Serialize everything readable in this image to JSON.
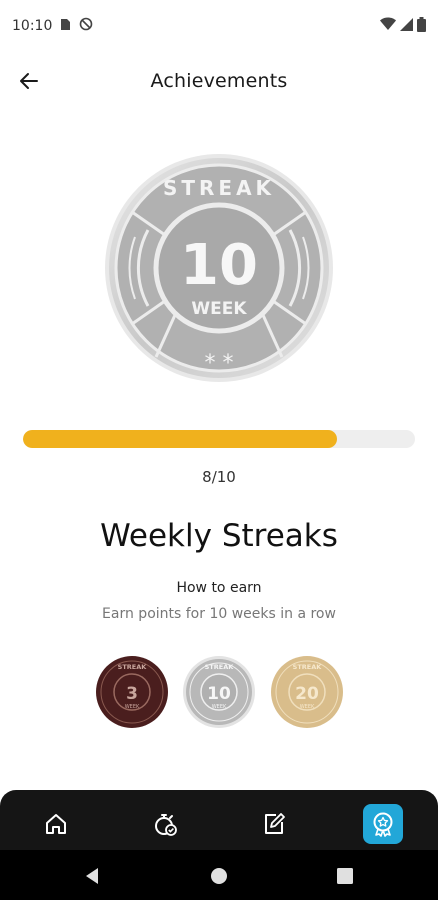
{
  "status_bar": {
    "time": "10:10"
  },
  "app_bar": {
    "title": "Achievements"
  },
  "hero_badge": {
    "banner": "STREAK",
    "number": "10",
    "unit": "WEEK",
    "stars": "* *"
  },
  "progress": {
    "current": 8,
    "total": 10,
    "fraction": 0.8,
    "label": "8/10"
  },
  "achievement": {
    "title": "Weekly Streaks",
    "how_to_earn": "How to earn",
    "description": "Earn points for 10 weeks in a row"
  },
  "levels": [
    {
      "banner": "STREAK",
      "number": "3",
      "unit": "WEEK",
      "color": "#4a1e1e"
    },
    {
      "banner": "STREAK",
      "number": "10",
      "unit": "WEEK",
      "color": "#b8b8b8"
    },
    {
      "banner": "STREAK",
      "number": "20",
      "unit": "WEEK",
      "color": "#d9bd8b"
    }
  ],
  "bottom_nav": {
    "items": [
      {
        "icon": "home-icon"
      },
      {
        "icon": "stopwatch-check-icon"
      },
      {
        "icon": "edit-note-icon"
      },
      {
        "icon": "award-badge-icon",
        "active": true
      }
    ],
    "active_color": "#22a7d8"
  },
  "colors": {
    "progress_fill": "#f0b11d",
    "progress_track": "#eeeeee"
  }
}
